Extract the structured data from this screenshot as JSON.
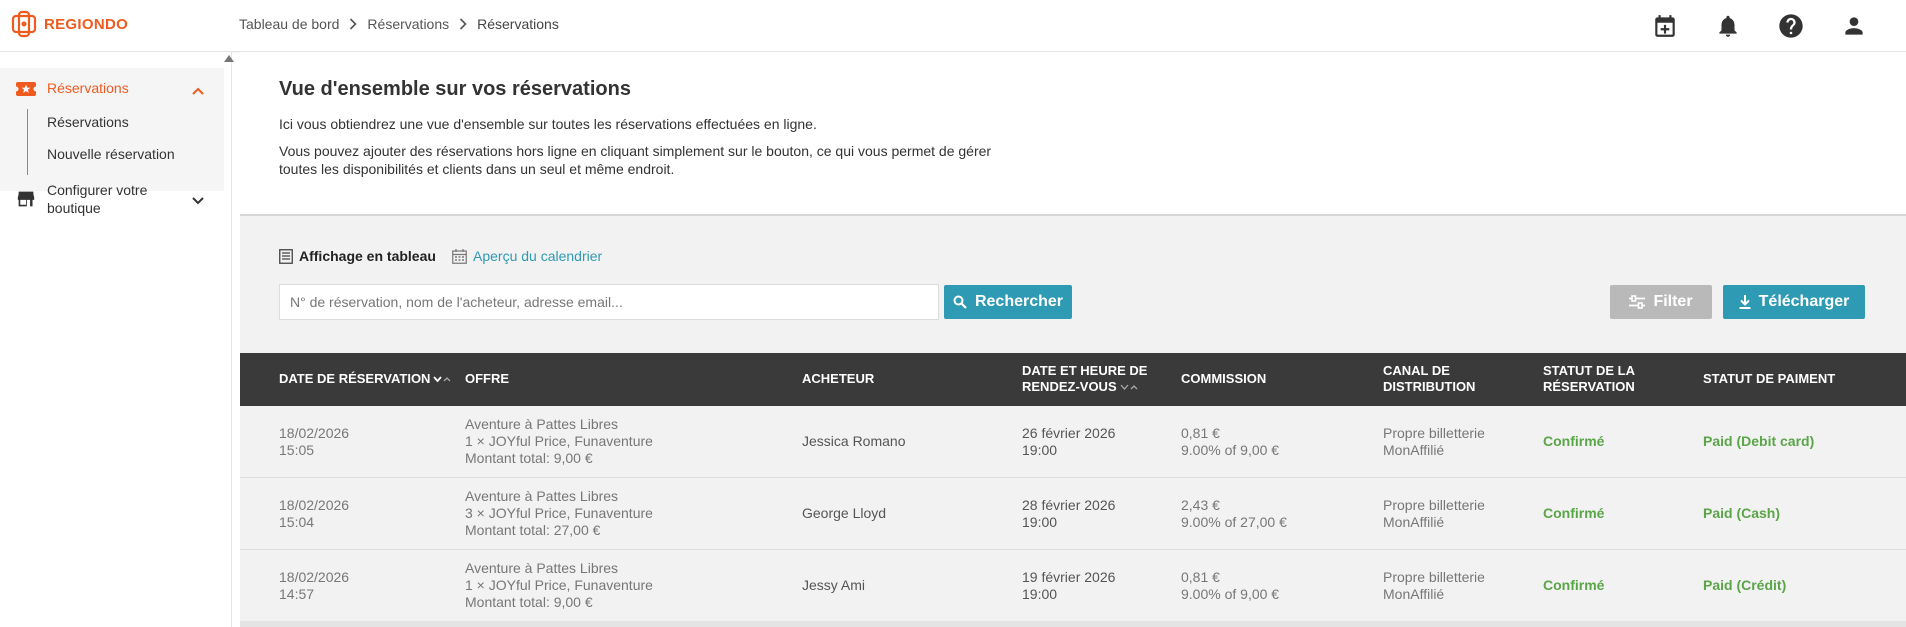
{
  "brand": {
    "name": "REGIONDO",
    "accent": "#ef5a1f",
    "teal": "#2e9ab3",
    "green": "#5aa548"
  },
  "breadcrumb": [
    "Tableau de bord",
    "Réservations",
    "Réservations"
  ],
  "topbar": {
    "icons": [
      "calendar-add-icon",
      "bell-icon",
      "help-icon",
      "account-icon"
    ]
  },
  "sidebar": {
    "reservations": "Réservations",
    "sub": [
      "Réservations",
      "Nouvelle réservation"
    ],
    "config": "Configurer votre boutique"
  },
  "intro": {
    "title": "Vue d'ensemble sur vos réservations",
    "p1": "Ici vous obtiendrez une vue d'ensemble sur toutes les réservations effectuées en ligne.",
    "p2": "Vous pouvez ajouter des réservations hors ligne en cliquant simplement sur le bouton, ce qui vous permet de gérer toutes les disponibilités et clients dans un seul et même endroit."
  },
  "views": {
    "table": "Affichage en tableau",
    "calendar": "Aperçu du calendrier"
  },
  "search": {
    "placeholder": "N° de réservation, nom de l'acheteur, adresse email...",
    "value": ""
  },
  "buttons": {
    "search": "Rechercher",
    "filter": "Filter",
    "download": "Télécharger"
  },
  "table": {
    "headers": {
      "date": "Date de réservation",
      "offer": "Offre",
      "buyer": "Acheteur",
      "rdv1": "Date et heure de",
      "rdv2": "rendez-vous",
      "commission": "Commission",
      "channel1": "Canal de",
      "channel2": "distribution",
      "status1": "Statut de la",
      "status2": "réservation",
      "payment": "Statut de paiment"
    },
    "rows": [
      {
        "date": "18/02/2026",
        "time": "15:05",
        "offer": "Aventure à Pattes Libres",
        "offer_detail": "1 × JOYful Price, Funaventure",
        "total": "Montant total: 9,00 €",
        "buyer": "Jessica Romano",
        "rdv_date": "26 février 2026",
        "rdv_time": "19:00",
        "commission": "0,81 €",
        "commission_rate": "9.00% of 9,00 €",
        "channel": "Propre billetterie",
        "channel_sub": "MonAffilié",
        "status": "Confirmé",
        "payment": "Paid (Debit card)"
      },
      {
        "date": "18/02/2026",
        "time": "15:04",
        "offer": "Aventure à Pattes Libres",
        "offer_detail": "3 × JOYful Price, Funaventure",
        "total": "Montant total: 27,00 €",
        "buyer": "George Lloyd",
        "rdv_date": "28 février 2026",
        "rdv_time": "19:00",
        "commission": "2,43 €",
        "commission_rate": "9.00% of 27,00 €",
        "channel": "Propre billetterie",
        "channel_sub": "MonAffilié",
        "status": "Confirmé",
        "payment": "Paid (Cash)"
      },
      {
        "date": "18/02/2026",
        "time": "14:57",
        "offer": "Aventure à Pattes Libres",
        "offer_detail": "1 × JOYful Price, Funaventure",
        "total": "Montant total: 9,00 €",
        "buyer": "Jessy Ami",
        "rdv_date": "19 février 2026",
        "rdv_time": "19:00",
        "commission": "0,81 €",
        "commission_rate": "9.00% of 9,00 €",
        "channel": "Propre billetterie",
        "channel_sub": "MonAffilié",
        "status": "Confirmé",
        "payment": "Paid (Crédit)"
      }
    ]
  }
}
